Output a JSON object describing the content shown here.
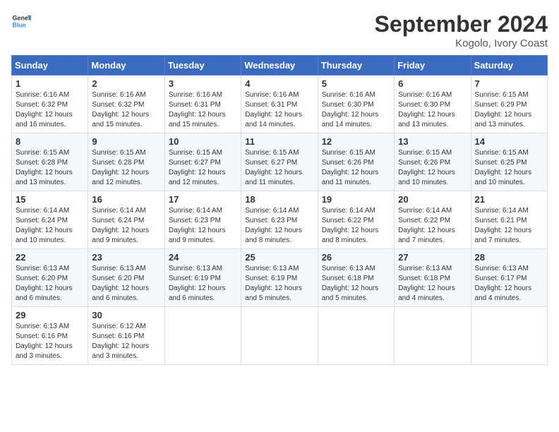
{
  "header": {
    "logo_general": "General",
    "logo_blue": "Blue",
    "month_title": "September 2024",
    "location": "Kogolo, Ivory Coast"
  },
  "weekdays": [
    "Sunday",
    "Monday",
    "Tuesday",
    "Wednesday",
    "Thursday",
    "Friday",
    "Saturday"
  ],
  "weeks": [
    [
      {
        "day": "1",
        "sunrise": "6:16 AM",
        "sunset": "6:32 PM",
        "daylight": "12 hours and 16 minutes."
      },
      {
        "day": "2",
        "sunrise": "6:16 AM",
        "sunset": "6:32 PM",
        "daylight": "12 hours and 15 minutes."
      },
      {
        "day": "3",
        "sunrise": "6:16 AM",
        "sunset": "6:31 PM",
        "daylight": "12 hours and 15 minutes."
      },
      {
        "day": "4",
        "sunrise": "6:16 AM",
        "sunset": "6:31 PM",
        "daylight": "12 hours and 14 minutes."
      },
      {
        "day": "5",
        "sunrise": "6:16 AM",
        "sunset": "6:30 PM",
        "daylight": "12 hours and 14 minutes."
      },
      {
        "day": "6",
        "sunrise": "6:16 AM",
        "sunset": "6:30 PM",
        "daylight": "12 hours and 13 minutes."
      },
      {
        "day": "7",
        "sunrise": "6:15 AM",
        "sunset": "6:29 PM",
        "daylight": "12 hours and 13 minutes."
      }
    ],
    [
      {
        "day": "8",
        "sunrise": "6:15 AM",
        "sunset": "6:28 PM",
        "daylight": "12 hours and 13 minutes."
      },
      {
        "day": "9",
        "sunrise": "6:15 AM",
        "sunset": "6:28 PM",
        "daylight": "12 hours and 12 minutes."
      },
      {
        "day": "10",
        "sunrise": "6:15 AM",
        "sunset": "6:27 PM",
        "daylight": "12 hours and 12 minutes."
      },
      {
        "day": "11",
        "sunrise": "6:15 AM",
        "sunset": "6:27 PM",
        "daylight": "12 hours and 11 minutes."
      },
      {
        "day": "12",
        "sunrise": "6:15 AM",
        "sunset": "6:26 PM",
        "daylight": "12 hours and 11 minutes."
      },
      {
        "day": "13",
        "sunrise": "6:15 AM",
        "sunset": "6:26 PM",
        "daylight": "12 hours and 10 minutes."
      },
      {
        "day": "14",
        "sunrise": "6:15 AM",
        "sunset": "6:25 PM",
        "daylight": "12 hours and 10 minutes."
      }
    ],
    [
      {
        "day": "15",
        "sunrise": "6:14 AM",
        "sunset": "6:24 PM",
        "daylight": "12 hours and 10 minutes."
      },
      {
        "day": "16",
        "sunrise": "6:14 AM",
        "sunset": "6:24 PM",
        "daylight": "12 hours and 9 minutes."
      },
      {
        "day": "17",
        "sunrise": "6:14 AM",
        "sunset": "6:23 PM",
        "daylight": "12 hours and 9 minutes."
      },
      {
        "day": "18",
        "sunrise": "6:14 AM",
        "sunset": "6:23 PM",
        "daylight": "12 hours and 8 minutes."
      },
      {
        "day": "19",
        "sunrise": "6:14 AM",
        "sunset": "6:22 PM",
        "daylight": "12 hours and 8 minutes."
      },
      {
        "day": "20",
        "sunrise": "6:14 AM",
        "sunset": "6:22 PM",
        "daylight": "12 hours and 7 minutes."
      },
      {
        "day": "21",
        "sunrise": "6:14 AM",
        "sunset": "6:21 PM",
        "daylight": "12 hours and 7 minutes."
      }
    ],
    [
      {
        "day": "22",
        "sunrise": "6:13 AM",
        "sunset": "6:20 PM",
        "daylight": "12 hours and 6 minutes."
      },
      {
        "day": "23",
        "sunrise": "6:13 AM",
        "sunset": "6:20 PM",
        "daylight": "12 hours and 6 minutes."
      },
      {
        "day": "24",
        "sunrise": "6:13 AM",
        "sunset": "6:19 PM",
        "daylight": "12 hours and 6 minutes."
      },
      {
        "day": "25",
        "sunrise": "6:13 AM",
        "sunset": "6:19 PM",
        "daylight": "12 hours and 5 minutes."
      },
      {
        "day": "26",
        "sunrise": "6:13 AM",
        "sunset": "6:18 PM",
        "daylight": "12 hours and 5 minutes."
      },
      {
        "day": "27",
        "sunrise": "6:13 AM",
        "sunset": "6:18 PM",
        "daylight": "12 hours and 4 minutes."
      },
      {
        "day": "28",
        "sunrise": "6:13 AM",
        "sunset": "6:17 PM",
        "daylight": "12 hours and 4 minutes."
      }
    ],
    [
      {
        "day": "29",
        "sunrise": "6:13 AM",
        "sunset": "6:16 PM",
        "daylight": "12 hours and 3 minutes."
      },
      {
        "day": "30",
        "sunrise": "6:12 AM",
        "sunset": "6:16 PM",
        "daylight": "12 hours and 3 minutes."
      },
      null,
      null,
      null,
      null,
      null
    ]
  ]
}
